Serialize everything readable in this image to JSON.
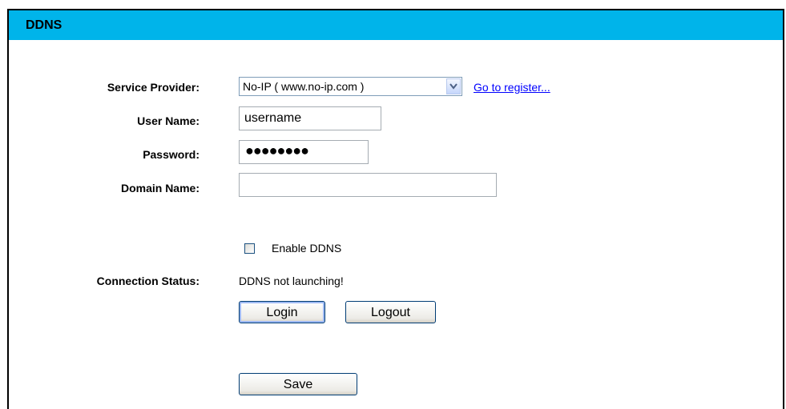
{
  "header": {
    "title": "DDNS"
  },
  "form": {
    "service_provider_label": "Service Provider:",
    "service_provider_value": "No-IP ( www.no-ip.com )",
    "register_link": "Go to register...",
    "username_label": "User Name:",
    "username_value": "username",
    "password_label": "Password:",
    "password_value": "●●●●●●●●",
    "domain_label": "Domain Name:",
    "domain_value": "",
    "enable_ddns_label": "Enable DDNS",
    "enable_ddns_checked": false,
    "connection_status_label": "Connection Status:",
    "connection_status_value": "DDNS not launching!"
  },
  "buttons": {
    "login": "Login",
    "logout": "Logout",
    "save": "Save"
  },
  "colors": {
    "header_bg": "#00b4ea",
    "link": "#0000ff"
  },
  "icons": {
    "dropdown": "chevron-down-icon"
  }
}
